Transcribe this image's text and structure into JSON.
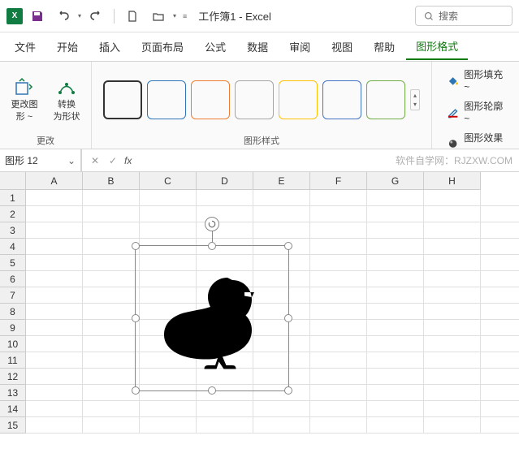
{
  "titlebar": {
    "title": "工作簿1 - Excel",
    "search_placeholder": "搜索"
  },
  "menu": {
    "items": [
      "文件",
      "开始",
      "插入",
      "页面布局",
      "公式",
      "数据",
      "审阅",
      "视图",
      "帮助",
      "图形格式"
    ],
    "active": "图形格式"
  },
  "ribbon": {
    "group_change": {
      "label": "更改",
      "change_shape": "更改图\n形 ~",
      "convert": "转换\n为形状"
    },
    "group_styles": {
      "label": "图形样式",
      "swatch_colors": [
        "#333333",
        "#2e75b6",
        "#ed7d31",
        "#a5a5a5",
        "#ffc000",
        "#4472c4",
        "#70ad47"
      ]
    },
    "fill": "图形填充 ~",
    "outline": "图形轮廓 ~",
    "effects": "图形效果 ~"
  },
  "formula_bar": {
    "name_box": "图形 12",
    "watermark": "软件自学网：RJZXW.COM"
  },
  "sheet": {
    "columns": [
      "A",
      "B",
      "C",
      "D",
      "E",
      "F",
      "G",
      "H"
    ],
    "rows": [
      "1",
      "2",
      "3",
      "4",
      "5",
      "6",
      "7",
      "8",
      "9",
      "10",
      "11",
      "12",
      "13",
      "14",
      "15"
    ]
  },
  "icons": {
    "save": "save",
    "undo": "undo",
    "redo": "redo",
    "new": "new",
    "open": "open",
    "change_shape": "change-shape",
    "convert": "convert-to-shape",
    "fill": "paint-bucket",
    "outline": "pen-outline",
    "effects": "fx-shape",
    "rotate": "rotate"
  }
}
